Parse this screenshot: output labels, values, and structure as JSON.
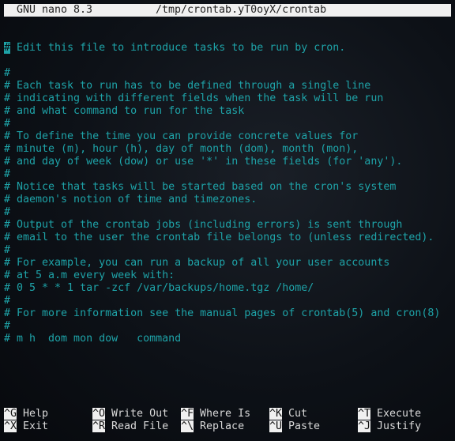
{
  "titlebar": {
    "app": "GNU nano 8.3",
    "file": "/tmp/crontab.yT0oyX/crontab"
  },
  "editor": {
    "lines": [
      "Edit this file to introduce tasks to be run by cron.",
      "#",
      "# Each task to run has to be defined through a single line",
      "# indicating with different fields when the task will be run",
      "# and what command to run for the task",
      "#",
      "# To define the time you can provide concrete values for",
      "# minute (m), hour (h), day of month (dom), month (mon),",
      "# and day of week (dow) or use '*' in these fields (for 'any').",
      "#",
      "# Notice that tasks will be started based on the cron's system",
      "# daemon's notion of time and timezones.",
      "#",
      "# Output of the crontab jobs (including errors) is sent through",
      "# email to the user the crontab file belongs to (unless redirected).",
      "#",
      "# For example, you can run a backup of all your user accounts",
      "# at 5 a.m every week with:",
      "# 0 5 * * 1 tar -zcf /var/backups/home.tgz /home/",
      "#",
      "# For more information see the manual pages of crontab(5) and cron(8)",
      "#",
      "# m h  dom mon dow   command"
    ],
    "cursor_char": "#",
    "first_line_rest": " Edit this file to introduce tasks to be run by cron."
  },
  "shortcuts": [
    [
      {
        "key": "^G",
        "label": "Help"
      },
      {
        "key": "^O",
        "label": "Write Out"
      },
      {
        "key": "^F",
        "label": "Where Is"
      },
      {
        "key": "^K",
        "label": "Cut"
      },
      {
        "key": "^T",
        "label": "Execute"
      }
    ],
    [
      {
        "key": "^X",
        "label": "Exit"
      },
      {
        "key": "^R",
        "label": "Read File"
      },
      {
        "key": "^\\",
        "label": "Replace"
      },
      {
        "key": "^U",
        "label": "Paste"
      },
      {
        "key": "^J",
        "label": "Justify"
      }
    ]
  ]
}
